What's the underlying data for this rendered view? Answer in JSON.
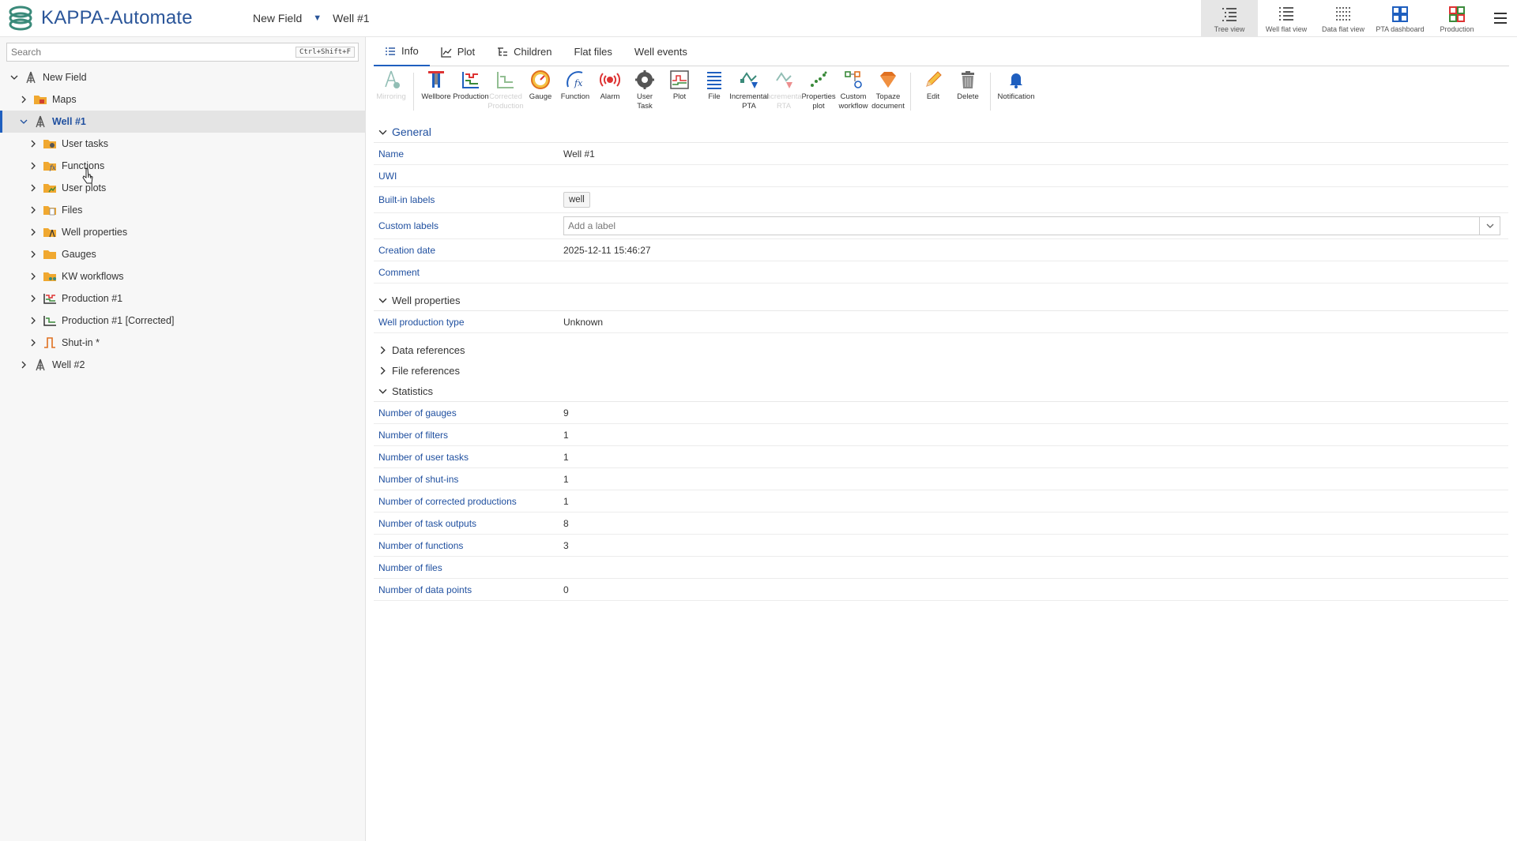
{
  "app": {
    "title": "KAPPA-Automate"
  },
  "breadcrumb": {
    "field": "New Field",
    "well": "Well #1"
  },
  "views": [
    {
      "label": "Tree view",
      "icon": "tree-view-icon"
    },
    {
      "label": "Well flat view",
      "icon": "well-flat-view-icon"
    },
    {
      "label": "Data flat view",
      "icon": "data-flat-view-icon"
    },
    {
      "label": "PTA dashboard",
      "icon": "pta-dashboard-icon"
    },
    {
      "label": "Production",
      "icon": "production-dashboard-icon"
    }
  ],
  "search": {
    "placeholder": "Search",
    "shortcut": "Ctrl+Shift+F"
  },
  "tree": {
    "root": "New Field",
    "maps": "Maps",
    "well1": "Well #1",
    "children": [
      "User tasks",
      "Functions",
      "User plots",
      "Files",
      "Well properties",
      "Gauges",
      "KW workflows",
      "Production #1",
      "Production #1 [Corrected]",
      "Shut-in *"
    ],
    "well2": "Well #2"
  },
  "tabs": [
    "Info",
    "Plot",
    "Children",
    "Flat files",
    "Well events"
  ],
  "toolbar": [
    {
      "label": "Mirroring",
      "icon": "mirroring-icon",
      "enabled": false
    },
    {
      "label": "Wellbore",
      "icon": "wellbore-icon",
      "enabled": true
    },
    {
      "label": "Production",
      "icon": "production-icon",
      "enabled": true
    },
    {
      "label": "Corrected\nProduction",
      "icon": "corrected-production-icon",
      "enabled": false
    },
    {
      "label": "Gauge",
      "icon": "gauge-icon",
      "enabled": true
    },
    {
      "label": "Function",
      "icon": "function-icon",
      "enabled": true
    },
    {
      "label": "Alarm",
      "icon": "alarm-icon",
      "enabled": true
    },
    {
      "label": "User\nTask",
      "icon": "user-task-icon",
      "enabled": true
    },
    {
      "label": "Plot",
      "icon": "plot-icon",
      "enabled": true
    },
    {
      "label": "File",
      "icon": "file-icon",
      "enabled": true
    },
    {
      "label": "Incremental\nPTA",
      "icon": "incremental-pta-icon",
      "enabled": true
    },
    {
      "label": "Incremental\nRTA",
      "icon": "incremental-rta-icon",
      "enabled": false
    },
    {
      "label": "Properties\nplot",
      "icon": "properties-plot-icon",
      "enabled": true
    },
    {
      "label": "Custom\nworkflow",
      "icon": "custom-workflow-icon",
      "enabled": true
    },
    {
      "label": "Topaze\ndocument",
      "icon": "topaze-document-icon",
      "enabled": true
    },
    {
      "label": "Edit",
      "icon": "edit-icon",
      "enabled": true
    },
    {
      "label": "Delete",
      "icon": "delete-icon",
      "enabled": true
    },
    {
      "label": "Notification",
      "icon": "notification-icon",
      "enabled": true
    }
  ],
  "general": {
    "title": "General",
    "name_label": "Name",
    "name_value": "Well #1",
    "uwi_label": "UWI",
    "builtin_label": "Built-in labels",
    "builtin_value": "well",
    "custom_label": "Custom labels",
    "custom_placeholder": "Add a label",
    "creation_label": "Creation date",
    "creation_value": "2025-12-11 15:46:27",
    "comment_label": "Comment"
  },
  "well_properties": {
    "title": "Well properties",
    "type_label": "Well production type",
    "type_value": "Unknown"
  },
  "data_references": {
    "title": "Data references"
  },
  "file_references": {
    "title": "File references"
  },
  "statistics": {
    "title": "Statistics",
    "rows": [
      {
        "k": "Number of gauges",
        "v": "9"
      },
      {
        "k": "Number of filters",
        "v": "1"
      },
      {
        "k": "Number of user tasks",
        "v": "1"
      },
      {
        "k": "Number of shut-ins",
        "v": "1"
      },
      {
        "k": "Number of corrected productions",
        "v": "1"
      },
      {
        "k": "Number of task outputs",
        "v": "8"
      },
      {
        "k": "Number of functions",
        "v": "3"
      },
      {
        "k": "Number of files",
        "v": ""
      },
      {
        "k": "Number of data points",
        "v": "0"
      }
    ]
  },
  "colors": {
    "accent": "#1f5fbf",
    "link": "#1f4f9f",
    "folder": "#f0a830"
  }
}
